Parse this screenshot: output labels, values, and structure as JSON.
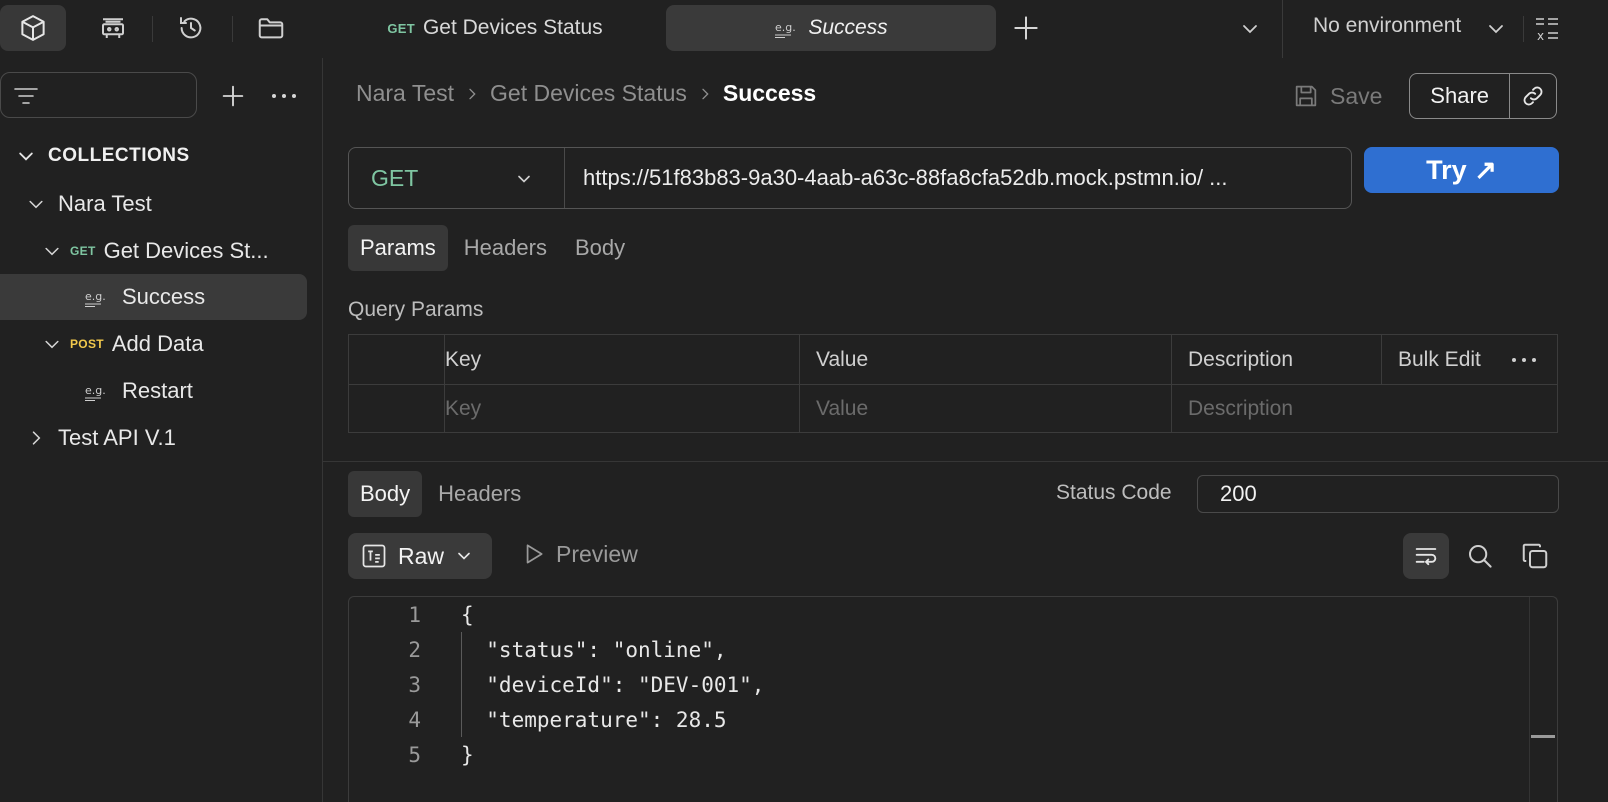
{
  "tabs": [
    {
      "method": "GET",
      "title": "Get Devices Status",
      "active": false
    },
    {
      "title": "Success",
      "active": true
    }
  ],
  "environment": "No environment",
  "sidebar": {
    "collections_title": "COLLECTIONS",
    "items": [
      {
        "label": "Nara Test",
        "type": "collection",
        "expanded": true
      },
      {
        "label": "Get Devices St...",
        "method": "GET",
        "type": "request",
        "expanded": true
      },
      {
        "label": "Success",
        "type": "example",
        "selected": true
      },
      {
        "label": "Add Data",
        "method": "POST",
        "type": "request",
        "expanded": true
      },
      {
        "label": "Restart",
        "type": "example"
      },
      {
        "label": "Test API V.1",
        "type": "collection",
        "expanded": false
      }
    ]
  },
  "breadcrumb": [
    "Nara Test",
    "Get Devices Status",
    "Success"
  ],
  "actions": {
    "save": "Save",
    "share": "Share"
  },
  "request": {
    "method": "GET",
    "url": "https://51f83b83-9a30-4aab-a63c-88fa8cfa52db.mock.pstmn.io/ ...",
    "try_label": "Try ↗"
  },
  "request_tabs": [
    "Params",
    "Headers",
    "Body"
  ],
  "query_params": {
    "label": "Query Params",
    "columns": [
      "Key",
      "Value",
      "Description"
    ],
    "bulk_edit": "Bulk Edit",
    "placeholders": [
      "Key",
      "Value",
      "Description"
    ]
  },
  "response_tabs": [
    "Body",
    "Headers"
  ],
  "status_code": {
    "label": "Status Code",
    "value": "200"
  },
  "body_format": "Raw",
  "preview_label": "Preview",
  "code": {
    "line_numbers": [
      "1",
      "2",
      "3",
      "4",
      "5"
    ],
    "lines": [
      "{",
      "  \"status\": \"online\",",
      "  \"deviceId\": \"DEV-001\",",
      "  \"temperature\": 28.5",
      "}"
    ]
  },
  "colors": {
    "accent": "#2f6fd1",
    "get": "#7fc6a2",
    "post": "#f2c94c",
    "background": "#212121"
  }
}
